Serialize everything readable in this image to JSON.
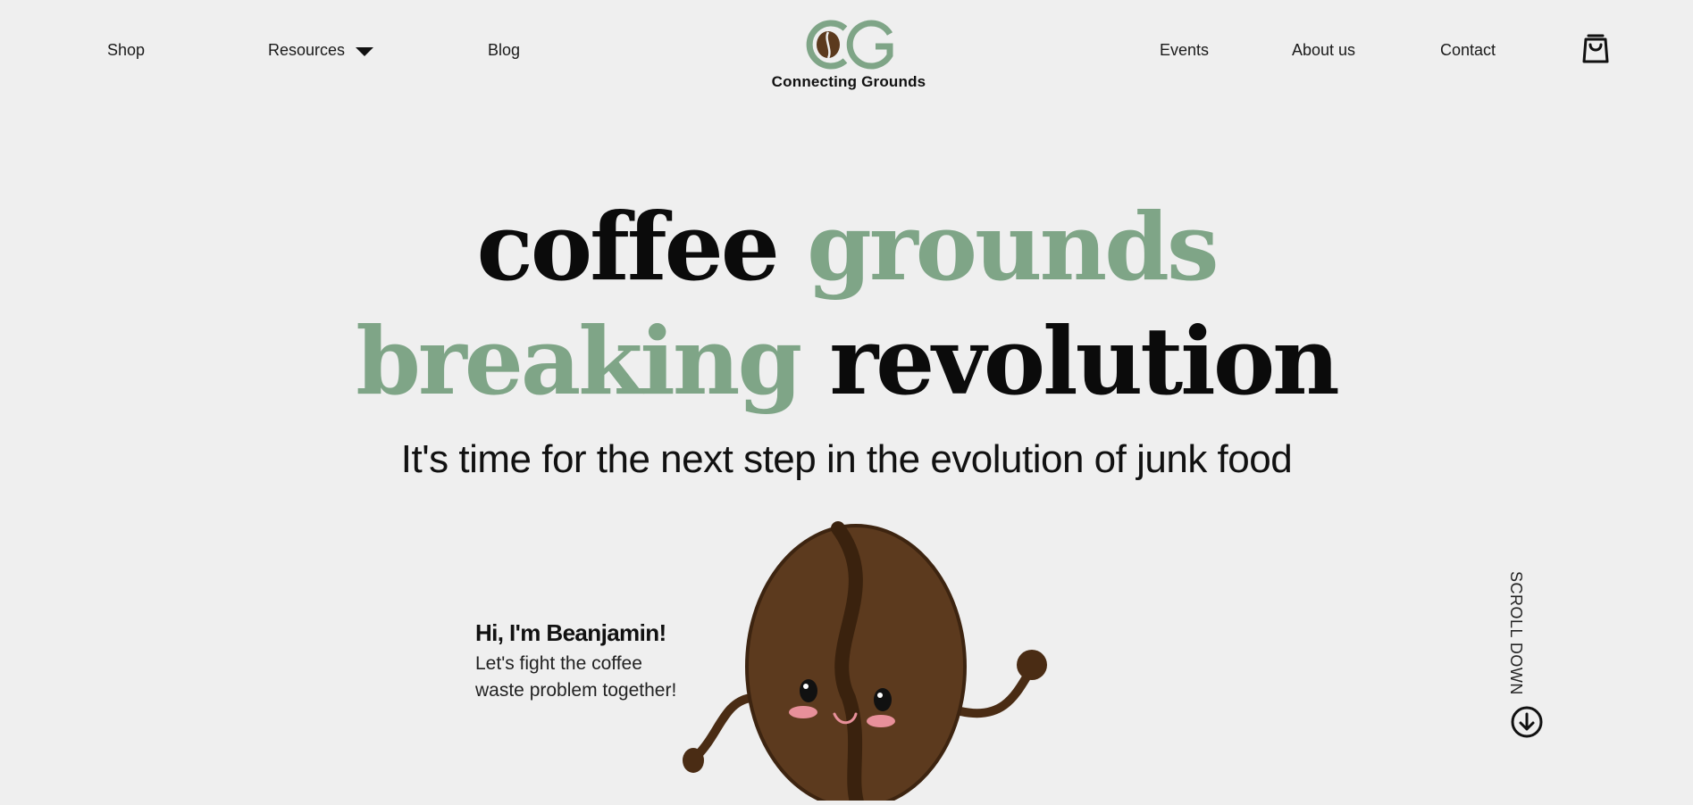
{
  "brand": {
    "name": "Connecting Grounds",
    "initials": "CG",
    "accent": "#7fa587",
    "bean_color": "#5c3a1e"
  },
  "nav": {
    "shop": "Shop",
    "resources": "Resources",
    "blog": "Blog",
    "events": "Events",
    "about": "About us",
    "contact": "Contact",
    "cart_icon": "shopping-bag-icon",
    "resources_icon": "caret-down-icon"
  },
  "hero": {
    "line1_a": "coffee",
    "line1_b": "grounds",
    "line2_a": "breaking",
    "line2_b": "revolution",
    "subtitle": "It's time for the next step in the evolution of junk food"
  },
  "mascot": {
    "title": "Hi, I'm Beanjamin!",
    "text": "Let's fight the coffee waste problem together!"
  },
  "scroll": {
    "label": "SCROLL DOWN",
    "icon": "arrow-down-circle-icon"
  }
}
